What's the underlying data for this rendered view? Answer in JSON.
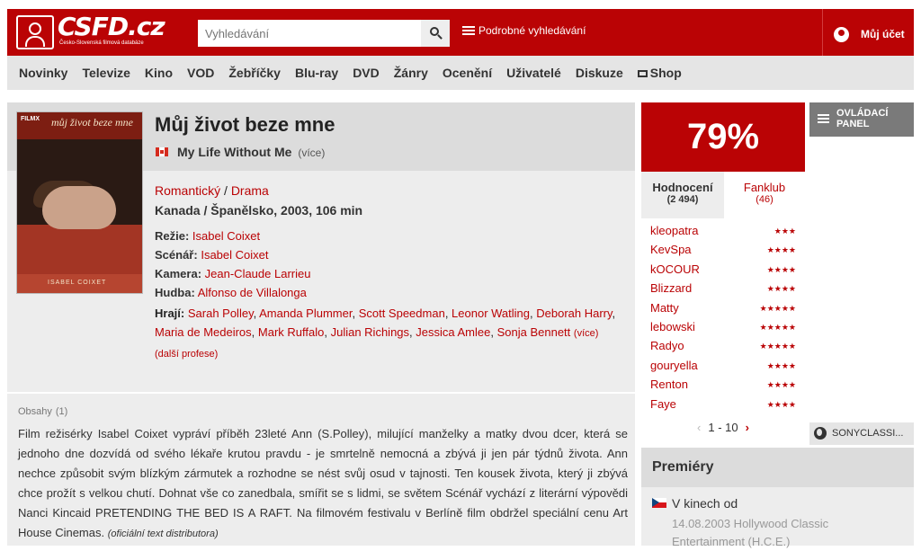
{
  "header": {
    "logo_text": "CSFD.cz",
    "logo_subtitle": "Česko-Slovenská filmová databáze",
    "search_placeholder": "Vyhledávání",
    "advanced_search": "Podrobné vyhledávání",
    "account": "Můj účet",
    "brand_color": "#ba0305"
  },
  "nav": {
    "items": [
      "Novinky",
      "Televize",
      "Kino",
      "VOD",
      "Žebříčky",
      "Blu-ray",
      "DVD",
      "Žánry",
      "Ocenění",
      "Uživatelé",
      "Diskuze",
      "Shop"
    ]
  },
  "movie": {
    "title": "Můj život beze mne",
    "original_title": "My Life Without Me",
    "more_titles": "více",
    "genre1": "Romantický",
    "genre_sep": "/",
    "genre2": "Drama",
    "origin": "Kanada / Španělsko, 2003, 106 min",
    "directing_label": "Režie:",
    "director": "Isabel Coixet",
    "screenplay_label": "Scénář:",
    "screenplay": "Isabel Coixet",
    "camera_label": "Kamera:",
    "camera": "Jean-Claude Larrieu",
    "music_label": "Hudba:",
    "music": "Alfonso de Villalonga",
    "cast_label": "Hrají:",
    "cast": [
      "Sarah Polley",
      "Amanda Plummer",
      "Scott Speedman",
      "Leonor Watling",
      "Deborah Harry",
      "Maria de Medeiros",
      "Mark Ruffalo",
      "Julian Richings",
      "Jessica Amlee",
      "Sonja Bennett"
    ],
    "cast_more": "více",
    "other_professions": "další profese",
    "poster": {
      "title_text": "můj život beze mne",
      "badge": "FILMX",
      "author": "ISABEL COIXET"
    }
  },
  "plot": {
    "heading": "Obsahy",
    "count": "(1)",
    "text": "Film režisérky Isabel Coixet vypráví příběh 23leté Ann (S.Polley), milující manželky a matky dvou dcer, která se jednoho dne dozvídá od svého lékaře krutou pravdu - je smrtelně nemocná a zbývá ji jen pár týdnů života. Ann nechce způsobit svým blízkým zármutek a rozhodne se nést svůj osud v tajnosti. Ten kousek života, který ji zbývá chce prožít s velkou chutí. Dohnat vše co zanedbala, smířit se s lidmi, se světem Scénář vychází z literární výpovědi Nanci Kincaid PRETENDING THE BED IS A RAFT. Na filmovém festivalu v Berlíně film obdržel speciální cenu Art House Cinemas.",
    "source": "(oficiální text distributora)"
  },
  "rating": {
    "percent": "79%",
    "tab_ratings": "Hodnocení",
    "ratings_count": "(2 494)",
    "tab_fanclub": "Fanklub",
    "fanclub_count": "(46)",
    "users": [
      {
        "name": "kleopatra",
        "stars": "★★★"
      },
      {
        "name": "KevSpa",
        "stars": "★★★★"
      },
      {
        "name": "kOCOUR",
        "stars": "★★★★"
      },
      {
        "name": "Blizzard",
        "stars": "★★★★"
      },
      {
        "name": "Matty",
        "stars": "★★★★★"
      },
      {
        "name": "lebowski",
        "stars": "★★★★★"
      },
      {
        "name": "Radyo",
        "stars": "★★★★★"
      },
      {
        "name": "gouryella",
        "stars": "★★★★"
      },
      {
        "name": "Renton",
        "stars": "★★★★"
      },
      {
        "name": "Faye",
        "stars": "★★★★"
      }
    ],
    "pager": "1 - 10"
  },
  "side": {
    "panel_label": "OVLÁDACÍ PANEL",
    "sony": "SONYCLASSI..."
  },
  "premieres": {
    "heading": "Premiéry",
    "where": "V kinech od",
    "date": "14.08.2003 Hollywood Classic Entertainment (H.C.E.)"
  }
}
